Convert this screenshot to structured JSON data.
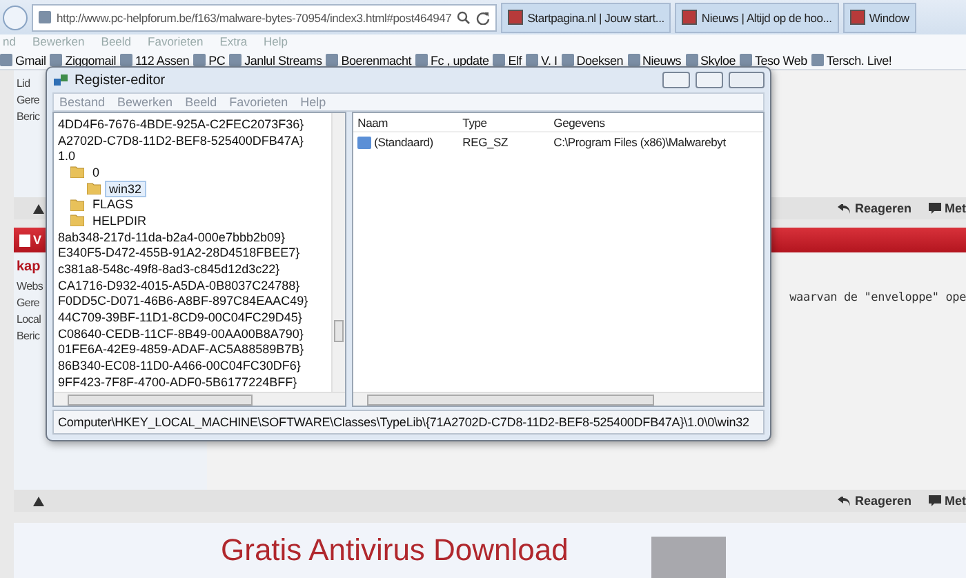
{
  "browser": {
    "url": "http://www.pc-helpforum.be/f163/malware-bytes-70954/index3.html#post464947",
    "tabs": [
      {
        "label": "Startpagina.nl | Jouw start...",
        "selected": false
      },
      {
        "label": "Nieuws | Altijd op de hoo...",
        "selected": false
      },
      {
        "label": "Window",
        "selected": false
      }
    ],
    "menu": [
      "nd",
      "Bewerken",
      "Beeld",
      "Favorieten",
      "Extra",
      "Help"
    ],
    "favorites": [
      "Gmail",
      "Ziggomail",
      "112 Assen",
      "PC",
      "Janlul Streams",
      "Boerenmacht",
      "Fc , update",
      "Elf",
      "V. I",
      "Doeksen",
      "Nieuws",
      "Skyloe",
      "Teso Web",
      "Tersch. Live!"
    ]
  },
  "page": {
    "top_labels": [
      "Lid",
      "Gere",
      "Beric"
    ],
    "action_bars": [
      {
        "actions": [
          "Reageren",
          "Met"
        ]
      },
      {
        "actions": [
          "Reageren",
          "Met"
        ]
      }
    ],
    "red_bar_label": "V",
    "author": "kap",
    "post_labels": [
      "Webs",
      "Gere",
      "Local",
      "Beric"
    ],
    "post_text": "waarvan de \"enveloppe\" ope",
    "ad": {
      "headline": "Gratis Antivirus Download"
    }
  },
  "regedit": {
    "title": "Register-editor",
    "menu": [
      "Bestand",
      "Bewerken",
      "Beeld",
      "Favorieten",
      "Help"
    ],
    "tree": [
      {
        "kind": "key",
        "label": "4DD4F6-7676-4BDE-925A-C2FEC2073F36}",
        "selected": false
      },
      {
        "kind": "key",
        "label": "A2702D-C7D8-11D2-BEF8-525400DFB47A}",
        "selected": false
      },
      {
        "kind": "key",
        "label": "1.0",
        "selected": false,
        "children": [
          {
            "kind": "folder",
            "label": "0",
            "selected": false,
            "children": [
              {
                "kind": "folder",
                "label": "win32",
                "selected": true
              }
            ]
          },
          {
            "kind": "folder",
            "label": "FLAGS",
            "selected": false
          },
          {
            "kind": "folder",
            "label": "HELPDIR",
            "selected": false
          }
        ]
      },
      {
        "kind": "key",
        "label": "8ab348-217d-11da-b2a4-000e7bbb2b09}",
        "selected": false
      },
      {
        "kind": "key",
        "label": "E340F5-D472-455B-91A2-28D4518FBEE7}",
        "selected": false
      },
      {
        "kind": "key",
        "label": "c381a8-548c-49f8-8ad3-c845d12d3c22}",
        "selected": false
      },
      {
        "kind": "key",
        "label": "CA1716-D932-4015-A5DA-0B8037C24788}",
        "selected": false
      },
      {
        "kind": "key",
        "label": "F0DD5C-D071-46B6-A8BF-897C84EAAC49}",
        "selected": false
      },
      {
        "kind": "key",
        "label": "44C709-39BF-11D1-8CD9-00C04FC29D45}",
        "selected": false
      },
      {
        "kind": "key",
        "label": "C08640-CEDB-11CF-8B49-00AA00B8A790}",
        "selected": false
      },
      {
        "kind": "key",
        "label": "01FE6A-42E9-4859-ADAF-AC5A88589B7B}",
        "selected": false
      },
      {
        "kind": "key",
        "label": "86B340-EC08-11D0-A466-00C04FC30DF6}",
        "selected": false
      },
      {
        "kind": "key",
        "label": "9FF423-7F8F-4700-ADF0-5B6177224BFF}",
        "selected": false
      }
    ],
    "columns": [
      "Naam",
      "Type",
      "Gegevens"
    ],
    "rows": [
      {
        "name": "(Standaard)",
        "type": "REG_SZ",
        "data": "C:\\Program Files (x86)\\Malwarebyt"
      }
    ],
    "status": "Computer\\HKEY_LOCAL_MACHINE\\SOFTWARE\\Classes\\TypeLib\\{71A2702D-C7D8-11D2-BEF8-525400DFB47A}\\1.0\\0\\win32"
  }
}
